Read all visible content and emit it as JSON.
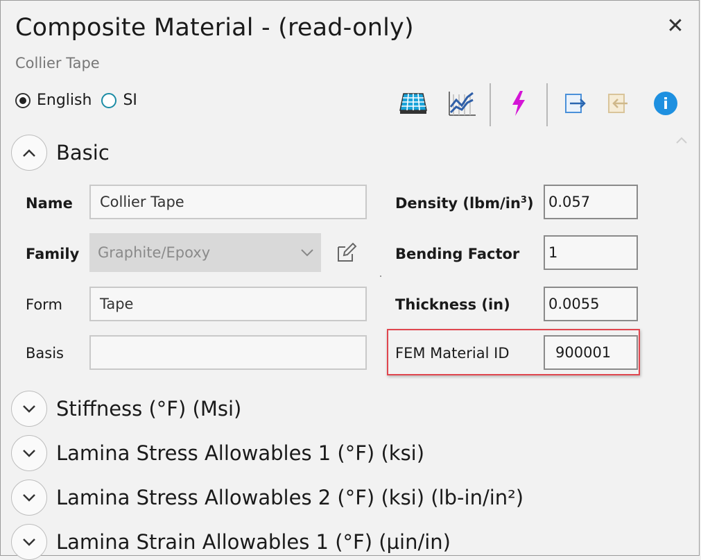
{
  "window": {
    "title": "Composite Material - (read-only)",
    "subtitle": "Collier Tape",
    "close_glyph": "✕"
  },
  "units": {
    "options": [
      {
        "label": "English",
        "selected": true
      },
      {
        "label": "SI",
        "selected": false
      }
    ]
  },
  "toolbar": {
    "icons": [
      "laminate-grid-icon",
      "chart-trend-icon",
      "lightning-icon",
      "export-icon",
      "import-icon",
      "info-icon"
    ],
    "colors": {
      "grid": "#1aa3d9",
      "chart": "#2f5fa8",
      "lightning": "#d415d6",
      "export": "#4a90d9",
      "import_disabled": "#d9c49a",
      "info": "#1e90e0"
    },
    "info_glyph": "i"
  },
  "basic": {
    "title": "Basic",
    "name_label": "Name",
    "name_value": "Collier Tape",
    "family_label": "Family",
    "family_value": "Graphite/Epoxy",
    "form_label": "Form",
    "form_value": "Tape",
    "basis_label": "Basis",
    "basis_value": "",
    "density_label": "Density (lbm/in",
    "density_sup": "3",
    "density_close": ")",
    "density_value": "0.057",
    "bending_label": "Bending Factor",
    "bending_value": "1",
    "thickness_label": "Thickness (in)",
    "thickness_value": "0.0055",
    "fem_label": "FEM Material ID",
    "fem_value": "900001",
    "highlight_color": "#e0464e"
  },
  "sections": [
    {
      "label": "Stiffness (°F) (Msi)"
    },
    {
      "label": "Lamina Stress Allowables 1 (°F) (ksi)"
    },
    {
      "label": "Lamina Stress Allowables 2 (°F) (ksi) (lb-in/in²)"
    },
    {
      "label": "Lamina Strain Allowables 1 (°F) (µin/in)"
    }
  ]
}
